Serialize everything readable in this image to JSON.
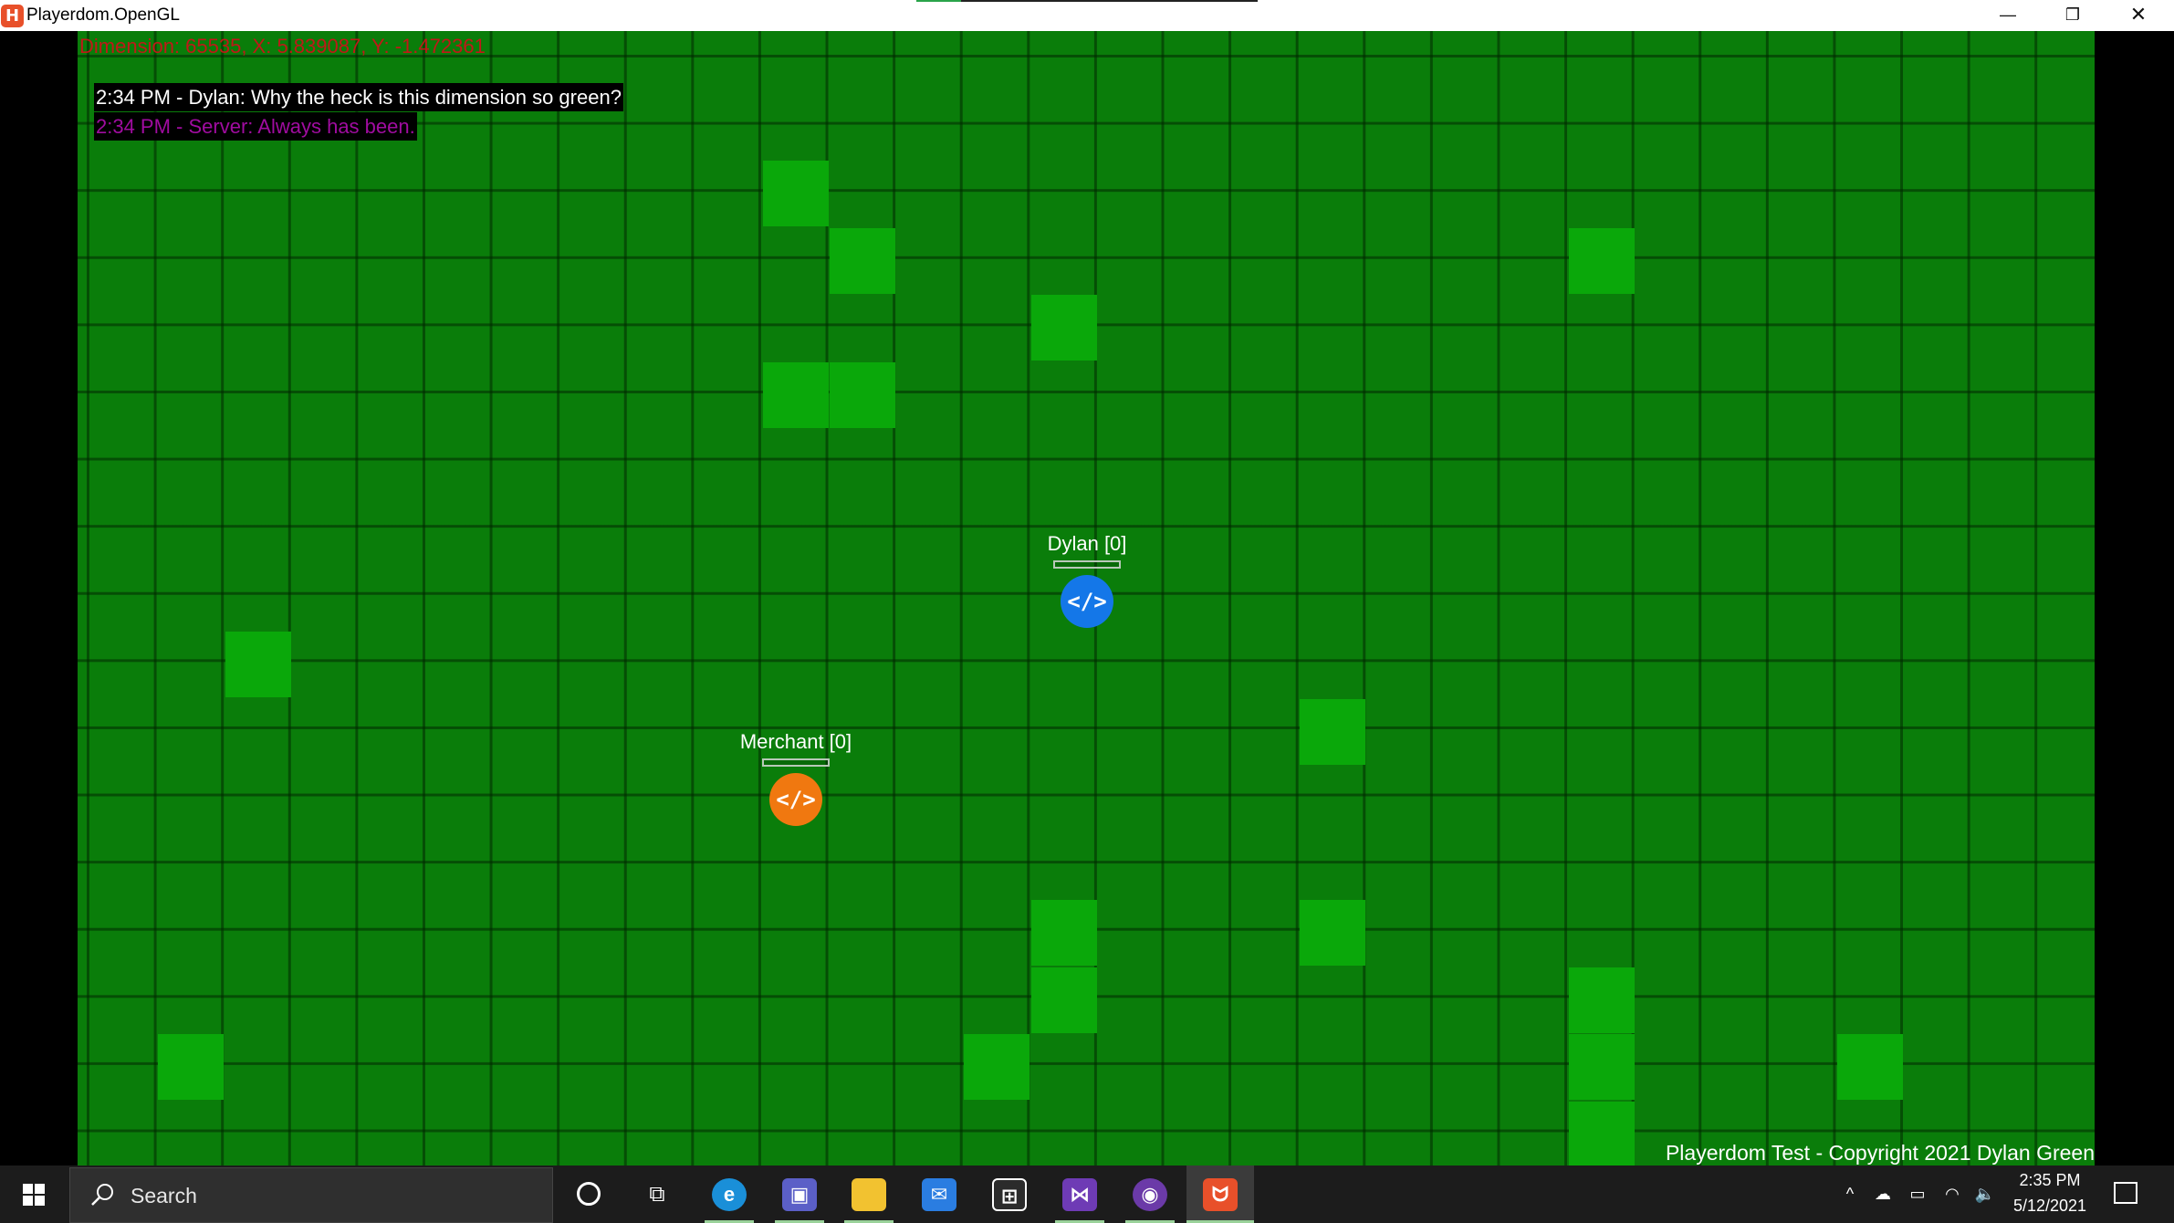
{
  "window": {
    "title": "Playerdom.OpenGL",
    "icon_name": "playerdom-app-icon",
    "progress": 0.13,
    "minimize_glyph": "—",
    "maximize_glyph": "❐",
    "close_glyph": "✕"
  },
  "hud": {
    "coords": "Dimension: 65535, X: 5.839087, Y: -1.472361",
    "coords_color": "#c01818"
  },
  "chat": [
    {
      "text": "2:34 PM - Dylan: Why the heck is this dimension so green?",
      "color": "#ffffff"
    },
    {
      "text": "2:34 PM - Server: Always has been.",
      "color": "#a00ca0"
    }
  ],
  "entities": {
    "player": {
      "name": "Dylan [0]",
      "avatar_glyph": "</>",
      "color": "#1477e8"
    },
    "merchant": {
      "name": "Merchant [0]",
      "avatar_glyph": "</>",
      "color": "#f07810"
    }
  },
  "footer": {
    "copyright": "Playerdom Test - Copyright 2021 Dylan Green"
  },
  "colors": {
    "grass": "#0a7d0a",
    "highlight_tile": "#0aa80a",
    "taskbar": "#1c1c1c"
  },
  "taskbar": {
    "search_placeholder": "Search",
    "apps": [
      {
        "name": "cortana-icon"
      },
      {
        "name": "task-view-icon"
      },
      {
        "name": "edge-icon"
      },
      {
        "name": "teams-icon"
      },
      {
        "name": "file-explorer-icon"
      },
      {
        "name": "mail-icon"
      },
      {
        "name": "store-icon"
      },
      {
        "name": "visual-studio-icon"
      },
      {
        "name": "app-icon"
      },
      {
        "name": "playerdom-taskbar-icon"
      }
    ],
    "time": "2:35 PM",
    "date": "5/12/2021"
  }
}
